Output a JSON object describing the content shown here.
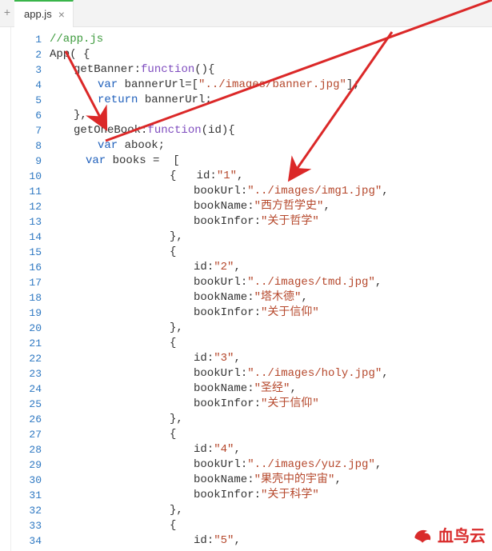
{
  "tab": {
    "filename": "app.js",
    "close_glyph": "×",
    "add_glyph": "+"
  },
  "gutter": {
    "start": 1,
    "end": 34
  },
  "code_lines": [
    {
      "idx": 1,
      "parts": [
        {
          "t": "//app.js",
          "c": "comment"
        }
      ],
      "indent": 0
    },
    {
      "idx": 2,
      "parts": [
        {
          "t": "App( {",
          "c": "ident"
        }
      ],
      "indent": 0
    },
    {
      "idx": 3,
      "parts": [
        {
          "t": "getBanner",
          "c": "ident"
        },
        {
          "t": ":",
          "c": "punct"
        },
        {
          "t": "function",
          "c": "fn"
        },
        {
          "t": "(){",
          "c": "punct"
        }
      ],
      "indent": 2
    },
    {
      "idx": 4,
      "parts": [
        {
          "t": "var",
          "c": "kw"
        },
        {
          "t": " bannerUrl=[",
          "c": "ident"
        },
        {
          "t": "\"../images/banner.jpg\"",
          "c": "str"
        },
        {
          "t": "];",
          "c": "punct"
        }
      ],
      "indent": 4
    },
    {
      "idx": 5,
      "parts": [
        {
          "t": "return",
          "c": "kw"
        },
        {
          "t": " bannerUrl;",
          "c": "ident"
        }
      ],
      "indent": 4
    },
    {
      "idx": 6,
      "parts": [
        {
          "t": "},",
          "c": "punct"
        }
      ],
      "indent": 2
    },
    {
      "idx": 7,
      "parts": [
        {
          "t": "getOneBook",
          "c": "ident"
        },
        {
          "t": ":",
          "c": "punct"
        },
        {
          "t": "function",
          "c": "fn"
        },
        {
          "t": "(id){",
          "c": "punct"
        }
      ],
      "indent": 2
    },
    {
      "idx": 8,
      "parts": [
        {
          "t": "var",
          "c": "kw"
        },
        {
          "t": " abook;",
          "c": "ident"
        }
      ],
      "indent": 4
    },
    {
      "idx": 9,
      "parts": [
        {
          "t": "var",
          "c": "kw"
        },
        {
          "t": " books =  [",
          "c": "ident"
        }
      ],
      "indent": 3
    },
    {
      "idx": 10,
      "parts": [
        {
          "t": "{   id",
          "c": "ident"
        },
        {
          "t": ":",
          "c": "punct"
        },
        {
          "t": "\"1\"",
          "c": "str"
        },
        {
          "t": ",",
          "c": "punct"
        }
      ],
      "indent": 10
    },
    {
      "idx": 11,
      "parts": [
        {
          "t": "bookUrl",
          "c": "ident"
        },
        {
          "t": ":",
          "c": "punct"
        },
        {
          "t": "\"../images/img1.jpg\"",
          "c": "str"
        },
        {
          "t": ",",
          "c": "punct"
        }
      ],
      "indent": 12
    },
    {
      "idx": 12,
      "parts": [
        {
          "t": "bookName",
          "c": "ident"
        },
        {
          "t": ":",
          "c": "punct"
        },
        {
          "t": "\"西方哲学史\"",
          "c": "str"
        },
        {
          "t": ",",
          "c": "punct"
        }
      ],
      "indent": 12
    },
    {
      "idx": 13,
      "parts": [
        {
          "t": "bookInfor",
          "c": "ident"
        },
        {
          "t": ":",
          "c": "punct"
        },
        {
          "t": "\"关于哲学\"",
          "c": "str"
        }
      ],
      "indent": 12
    },
    {
      "idx": 14,
      "parts": [
        {
          "t": "},",
          "c": "punct"
        }
      ],
      "indent": 10
    },
    {
      "idx": 15,
      "parts": [
        {
          "t": "{",
          "c": "punct"
        }
      ],
      "indent": 10
    },
    {
      "idx": 16,
      "parts": [
        {
          "t": "id",
          "c": "ident"
        },
        {
          "t": ":",
          "c": "punct"
        },
        {
          "t": "\"2\"",
          "c": "str"
        },
        {
          "t": ",",
          "c": "punct"
        }
      ],
      "indent": 12
    },
    {
      "idx": 17,
      "parts": [
        {
          "t": "bookUrl",
          "c": "ident"
        },
        {
          "t": ":",
          "c": "punct"
        },
        {
          "t": "\"../images/tmd.jpg\"",
          "c": "str"
        },
        {
          "t": ",",
          "c": "punct"
        }
      ],
      "indent": 12
    },
    {
      "idx": 18,
      "parts": [
        {
          "t": "bookName",
          "c": "ident"
        },
        {
          "t": ":",
          "c": "punct"
        },
        {
          "t": "\"塔木德\"",
          "c": "str"
        },
        {
          "t": ",",
          "c": "punct"
        }
      ],
      "indent": 12
    },
    {
      "idx": 19,
      "parts": [
        {
          "t": "bookInfor",
          "c": "ident"
        },
        {
          "t": ":",
          "c": "punct"
        },
        {
          "t": "\"关于信仰\"",
          "c": "str"
        }
      ],
      "indent": 12
    },
    {
      "idx": 20,
      "parts": [
        {
          "t": "},",
          "c": "punct"
        }
      ],
      "indent": 10
    },
    {
      "idx": 21,
      "parts": [
        {
          "t": "{",
          "c": "punct"
        }
      ],
      "indent": 10
    },
    {
      "idx": 22,
      "parts": [
        {
          "t": "id",
          "c": "ident"
        },
        {
          "t": ":",
          "c": "punct"
        },
        {
          "t": "\"3\"",
          "c": "str"
        },
        {
          "t": ",",
          "c": "punct"
        }
      ],
      "indent": 12
    },
    {
      "idx": 23,
      "parts": [
        {
          "t": "bookUrl",
          "c": "ident"
        },
        {
          "t": ":",
          "c": "punct"
        },
        {
          "t": "\"../images/holy.jpg\"",
          "c": "str"
        },
        {
          "t": ",",
          "c": "punct"
        }
      ],
      "indent": 12
    },
    {
      "idx": 24,
      "parts": [
        {
          "t": "bookName",
          "c": "ident"
        },
        {
          "t": ":",
          "c": "punct"
        },
        {
          "t": "\"圣经\"",
          "c": "str"
        },
        {
          "t": ",",
          "c": "punct"
        }
      ],
      "indent": 12
    },
    {
      "idx": 25,
      "parts": [
        {
          "t": "bookInfor",
          "c": "ident"
        },
        {
          "t": ":",
          "c": "punct"
        },
        {
          "t": "\"关于信仰\"",
          "c": "str"
        }
      ],
      "indent": 12
    },
    {
      "idx": 26,
      "parts": [
        {
          "t": "},",
          "c": "punct"
        }
      ],
      "indent": 10
    },
    {
      "idx": 27,
      "parts": [
        {
          "t": "{",
          "c": "punct"
        }
      ],
      "indent": 10
    },
    {
      "idx": 28,
      "parts": [
        {
          "t": "id",
          "c": "ident"
        },
        {
          "t": ":",
          "c": "punct"
        },
        {
          "t": "\"4\"",
          "c": "str"
        },
        {
          "t": ",",
          "c": "punct"
        }
      ],
      "indent": 12
    },
    {
      "idx": 29,
      "parts": [
        {
          "t": "bookUrl",
          "c": "ident"
        },
        {
          "t": ":",
          "c": "punct"
        },
        {
          "t": "\"../images/yuz.jpg\"",
          "c": "str"
        },
        {
          "t": ",",
          "c": "punct"
        }
      ],
      "indent": 12
    },
    {
      "idx": 30,
      "parts": [
        {
          "t": "bookName",
          "c": "ident"
        },
        {
          "t": ":",
          "c": "punct"
        },
        {
          "t": "\"果壳中的宇宙\"",
          "c": "str"
        },
        {
          "t": ",",
          "c": "punct"
        }
      ],
      "indent": 12
    },
    {
      "idx": 31,
      "parts": [
        {
          "t": "bookInfor",
          "c": "ident"
        },
        {
          "t": ":",
          "c": "punct"
        },
        {
          "t": "\"关于科学\"",
          "c": "str"
        }
      ],
      "indent": 12
    },
    {
      "idx": 32,
      "parts": [
        {
          "t": "},",
          "c": "punct"
        }
      ],
      "indent": 10
    },
    {
      "idx": 33,
      "parts": [
        {
          "t": "{",
          "c": "punct"
        }
      ],
      "indent": 10
    },
    {
      "idx": 34,
      "parts": [
        {
          "t": "id",
          "c": "ident"
        },
        {
          "t": ":",
          "c": "punct"
        },
        {
          "t": "\"5\"",
          "c": "str"
        },
        {
          "t": ",",
          "c": "punct"
        }
      ],
      "indent": 12
    }
  ],
  "brand": {
    "text": "血鸟云"
  },
  "colors": {
    "arrow": "#db2828"
  }
}
